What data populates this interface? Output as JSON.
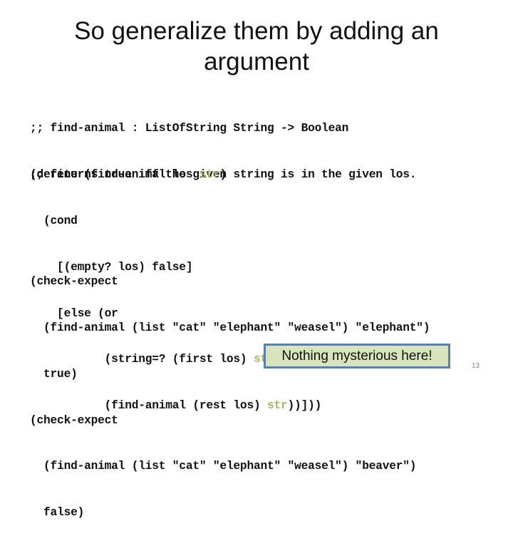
{
  "slide": {
    "title_line1": "So generalize them by adding an",
    "title_line2": "argument",
    "signature_comment": [
      ";; find-animal : ListOfString String -> Boolean",
      ";; returns true iff the given string is in the given los."
    ],
    "definition": [
      {
        "pre": "(define (find-animal los ",
        "hl": "str",
        "post": ")"
      },
      {
        "pre": "  (cond",
        "hl": "",
        "post": ""
      },
      {
        "pre": "    [(empty? los) false]",
        "hl": "",
        "post": ""
      },
      {
        "pre": "    [else (or",
        "hl": "",
        "post": ""
      },
      {
        "pre": "           (string=? (first los) ",
        "hl": "str",
        "post": ")"
      },
      {
        "pre": "           (find-animal (rest los) ",
        "hl": "str",
        "post": "))]))"
      }
    ],
    "tests": [
      "(check-expect",
      "  (find-animal (list \"cat\" \"elephant\" \"weasel\") \"elephant\")",
      "  true)",
      "(check-expect",
      "  (find-animal (list \"cat\" \"elephant\" \"weasel\") \"beaver\")",
      "  false)"
    ],
    "callout": "Nothing mysterious here!",
    "page_number": "13",
    "colors": {
      "highlight": "#a3b86a",
      "callout_fill": "#d8e4bc",
      "callout_border": "#5b7fa8"
    }
  }
}
